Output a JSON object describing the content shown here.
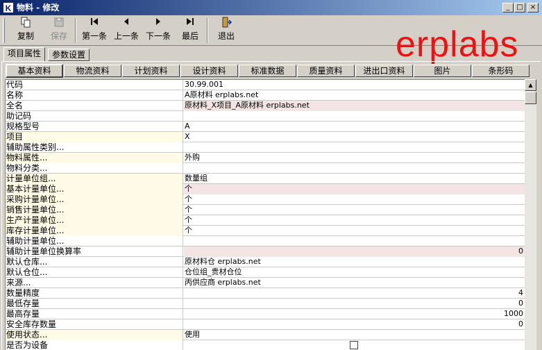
{
  "window": {
    "icon_letter": "K",
    "title": "物料 - 修改",
    "minimize": "_",
    "maximize": "□",
    "close": "×"
  },
  "toolbar": {
    "copy": "复制",
    "save": "保存",
    "first": "第一条",
    "prev": "上一条",
    "next": "下一条",
    "last": "最后",
    "exit": "退出"
  },
  "brand": "erplabs",
  "outer_tabs": [
    "项目属性",
    "参数设置"
  ],
  "inner_tabs": [
    "基本资料",
    "物流资料",
    "计划资料",
    "设计资料",
    "标准数据",
    "质量资料",
    "进出口资料",
    "图片",
    "条形码"
  ],
  "rows": [
    {
      "label": "代码",
      "value": "30.99.001"
    },
    {
      "label": "名称",
      "value": "A原材料 erplabs.net"
    },
    {
      "label": "全名",
      "value": "原材料_X项目_A原材料 erplabs.net"
    },
    {
      "label": "助记码",
      "value": ""
    },
    {
      "label": "规格型号",
      "value": "A"
    },
    {
      "label": "项目",
      "value": "X"
    },
    {
      "label": "辅助属性类别...",
      "value": ""
    },
    {
      "label": "物料属性...",
      "value": "外购"
    },
    {
      "label": "物料分类...",
      "value": ""
    },
    {
      "label": "计量单位组...",
      "value": "数量组"
    },
    {
      "label": "基本计量单位...",
      "value": "个"
    },
    {
      "label": "采购计量单位...",
      "value": "个"
    },
    {
      "label": "销售计量单位...",
      "value": "个"
    },
    {
      "label": "生产计量单位...",
      "value": "个"
    },
    {
      "label": "库存计量单位...",
      "value": "个"
    },
    {
      "label": "辅助计量单位...",
      "value": ""
    },
    {
      "label": "辅助计量单位换算率",
      "value": "0"
    },
    {
      "label": "默认仓库...",
      "value": "原材料仓 erplabs.net"
    },
    {
      "label": "默认仓位...",
      "value": "仓位组_贵材仓位"
    },
    {
      "label": "来源...",
      "value": "丙供应商 erplabs.net"
    },
    {
      "label": "数量精度",
      "value": "4"
    },
    {
      "label": "最低存量",
      "value": "0"
    },
    {
      "label": "最高存量",
      "value": "1000"
    },
    {
      "label": "安全库存数量",
      "value": "0"
    },
    {
      "label": "使用状态...",
      "value": "使用"
    },
    {
      "label": "是否为设备",
      "value": ""
    }
  ],
  "scrollbar": {
    "up": "▲",
    "down": "▼"
  }
}
